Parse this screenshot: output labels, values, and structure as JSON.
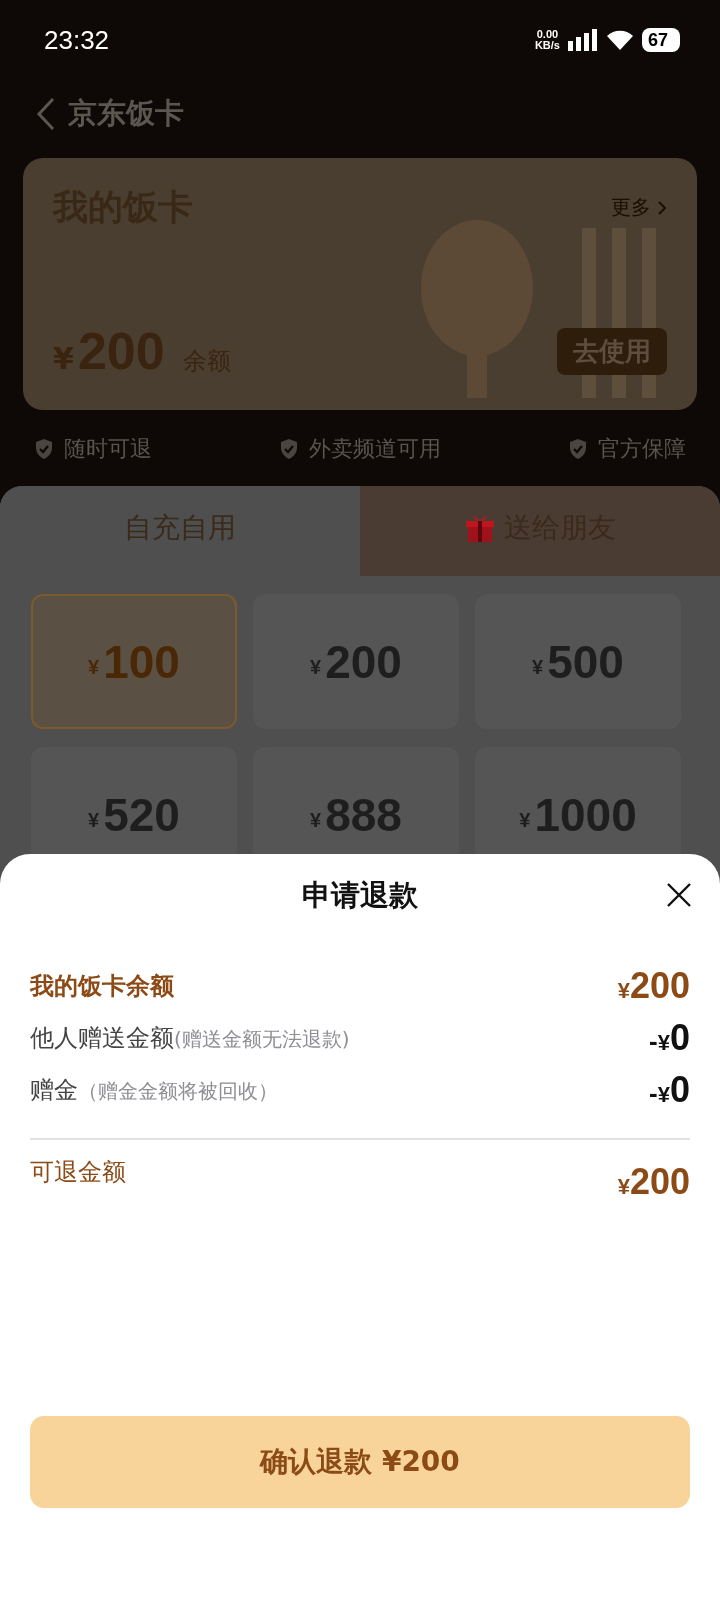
{
  "status_bar": {
    "time": "23:32",
    "net_speed": "0.00",
    "net_unit": "KB/s",
    "battery": "67"
  },
  "header": {
    "title": "京东饭卡"
  },
  "card": {
    "title": "我的饭卡",
    "more": "更多",
    "currency": "¥",
    "amount": "200",
    "amount_label": "余额",
    "use_button": "去使用"
  },
  "guarantees": [
    "随时可退",
    "外卖频道可用",
    "官方保障"
  ],
  "tabs": [
    {
      "label": "自充自用",
      "selected": true
    },
    {
      "label": "送给朋友",
      "selected": false
    }
  ],
  "amounts": [
    {
      "currency": "¥",
      "amount": "100",
      "selected": true
    },
    {
      "currency": "¥",
      "amount": "200",
      "selected": false
    },
    {
      "currency": "¥",
      "amount": "500",
      "selected": false
    },
    {
      "currency": "¥",
      "amount": "520",
      "selected": false
    },
    {
      "currency": "¥",
      "amount": "888",
      "selected": false
    },
    {
      "currency": "¥",
      "amount": "1000",
      "selected": false
    }
  ],
  "refund_sheet": {
    "title": "申请退款",
    "rows": [
      {
        "kind": "highlight",
        "label": "我的饭卡余额",
        "sign": "",
        "currency": "¥",
        "amount": "200"
      },
      {
        "kind": "deduct",
        "label": "他人赠送金额",
        "note": "(赠送金额无法退款)",
        "sign": "-",
        "currency": "¥",
        "amount": "0"
      },
      {
        "kind": "deduct",
        "label": "赠金",
        "note": "（赠金金额将被回收）",
        "sign": "-",
        "currency": "¥",
        "amount": "0"
      }
    ],
    "total": {
      "label": "可退金额",
      "currency": "¥",
      "amount": "200"
    },
    "confirm_button": "确认退款 ¥200"
  }
}
